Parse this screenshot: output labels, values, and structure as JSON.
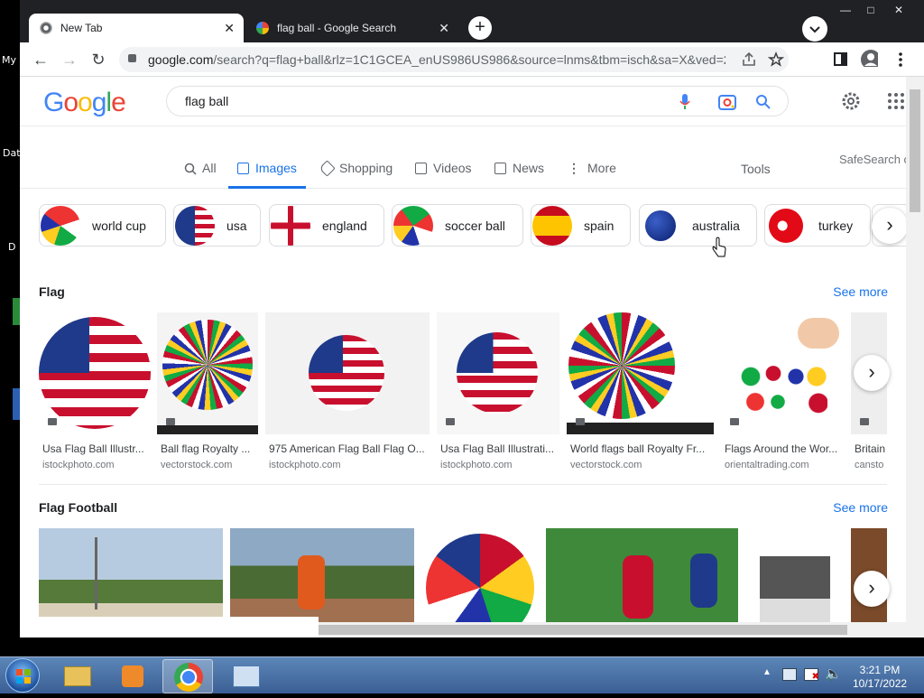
{
  "desktop": {
    "labels": [
      "My",
      "Dat",
      "D"
    ]
  },
  "browser": {
    "tabs": [
      {
        "title": "New Tab"
      },
      {
        "title": "flag ball - Google Search"
      }
    ],
    "new_tab_label": "+",
    "url_domain": "google.com",
    "url_rest": "/search?q=flag+ball&rlz=1C1GCEA_enUS986US986&source=lnms&tbm=isch&sa=X&ved=2ah..."
  },
  "google": {
    "logo": "Google",
    "query": "flag ball",
    "nav_tabs": [
      "All",
      "Images",
      "Shopping",
      "Videos",
      "News",
      "More"
    ],
    "tools": "Tools",
    "safesearch": "SafeSearch o",
    "chips": [
      "world cup",
      "usa",
      "england",
      "soccer ball",
      "spain",
      "australia",
      "turkey"
    ],
    "sections": [
      {
        "title": "Flag",
        "see_more": "See more",
        "items": [
          {
            "caption": "Usa Flag Ball Illustr...",
            "source": "istockphoto.com"
          },
          {
            "caption": "Ball flag Royalty ...",
            "source": "vectorstock.com"
          },
          {
            "caption": "975 American Flag Ball Flag O...",
            "source": "istockphoto.com"
          },
          {
            "caption": "Usa Flag Ball Illustrati...",
            "source": "istockphoto.com"
          },
          {
            "caption": "World flags ball Royalty Fr...",
            "source": "vectorstock.com"
          },
          {
            "caption": "Flags Around the Wor...",
            "source": "orientaltrading.com"
          },
          {
            "caption": "Britain",
            "source": "cansto"
          }
        ]
      },
      {
        "title": "Flag Football",
        "see_more": "See more"
      }
    ]
  },
  "taskbar": {
    "time": "3:21 PM",
    "date": "10/17/2022"
  },
  "colors": {
    "chrome_dark": "#202124",
    "link_blue": "#1a73e8",
    "taskbar": "#3b5f94"
  }
}
